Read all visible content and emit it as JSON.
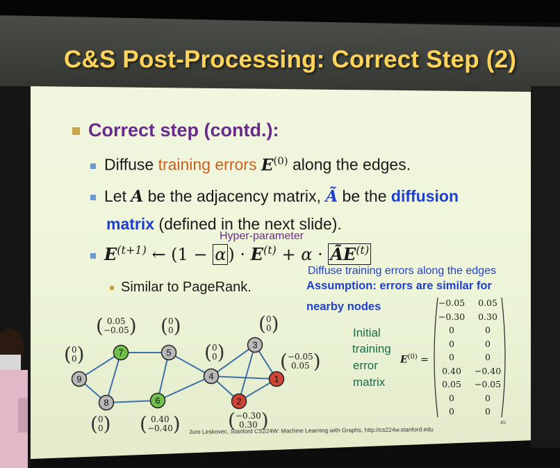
{
  "title": "C&S Post-Processing: Correct Step (2)",
  "heading": "Correct step (contd.):",
  "bullet1": {
    "pre": "Diffuse ",
    "hl": "training errors",
    "post": " along the edges."
  },
  "bullet2": {
    "p1": "Let ",
    "p2": " be the adjacency matrix, ",
    "p3": " be the ",
    "hl1": "diffusion",
    "hl2": "matrix",
    "p4": " (defined in the next slide)."
  },
  "hyper_label": "Hyper-parameter",
  "sub_bullet": "Similar to PageRank.",
  "diffuse_note": "Diffuse training errors along the edges",
  "assumption": [
    "Assumption: errors are similar for",
    "nearby nodes"
  ],
  "initial_label": [
    "Initial",
    "training",
    "error",
    "matrix"
  ],
  "matrix_rows": [
    [
      "−0.05",
      "0.05"
    ],
    [
      "−0.30",
      "0.30"
    ],
    [
      "0",
      "0"
    ],
    [
      "0",
      "0"
    ],
    [
      "0",
      "0"
    ],
    [
      "0.40",
      "−0.40"
    ],
    [
      "0.05",
      "−0.05"
    ],
    [
      "0",
      "0"
    ],
    [
      "0",
      "0"
    ]
  ],
  "nodes": [
    {
      "id": "1",
      "color": "#d04436"
    },
    {
      "id": "2",
      "color": "#d04436"
    },
    {
      "id": "3",
      "color": "#b8b8b8"
    },
    {
      "id": "4",
      "color": "#b8b8b8"
    },
    {
      "id": "5",
      "color": "#b8b8b8"
    },
    {
      "id": "6",
      "color": "#6fc04c"
    },
    {
      "id": "7",
      "color": "#6fc04c"
    },
    {
      "id": "8",
      "color": "#b8b8b8"
    },
    {
      "id": "9",
      "color": "#b8b8b8"
    }
  ],
  "node_vectors": {
    "v7": [
      "0.05",
      "−0.05"
    ],
    "v5": [
      "0",
      "0"
    ],
    "v3": [
      "0",
      "0"
    ],
    "v9": [
      "0",
      "0"
    ],
    "v4": [
      "0",
      "0"
    ],
    "v1": [
      "−0.05",
      "0.05"
    ],
    "v8": [
      "0",
      "0"
    ],
    "v6": [
      "0.40",
      "−0.40"
    ],
    "v2": [
      "−0.30",
      "0.30"
    ]
  },
  "footer": "Jure Leskovec, Stanford CS224W: Machine Learning with Graphs, http://cs224w.stanford.edu",
  "page_number": "45"
}
